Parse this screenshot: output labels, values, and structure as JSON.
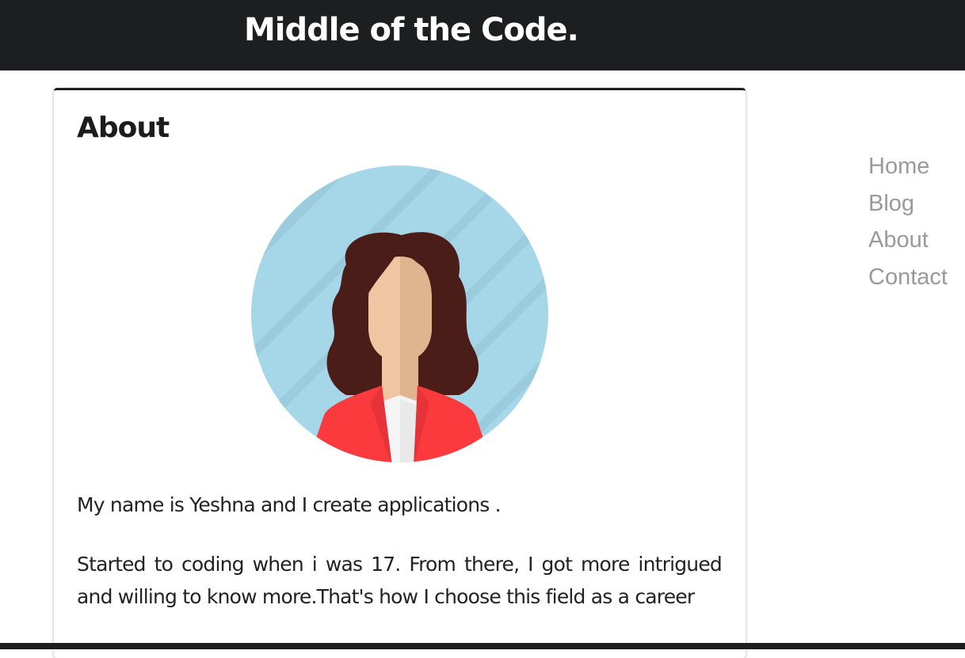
{
  "header": {
    "site_title": "Middle of the Code."
  },
  "about": {
    "heading": "About",
    "avatar_icon": "woman-avatar-icon",
    "paragraphs": [
      "My name is Yeshna and I create applications .",
      "Started to coding when i was 17. From there, I got more intrigued and willing to know more.That's how I choose this field as a career"
    ]
  },
  "nav": {
    "items": [
      {
        "label": "Home"
      },
      {
        "label": "Blog"
      },
      {
        "label": "About"
      },
      {
        "label": "Contact"
      }
    ]
  },
  "colors": {
    "header_bg": "#1d1e20",
    "nav_link": "#9a9a9a",
    "avatar_bg": "#a5d7e8",
    "hair": "#4a1d19",
    "skin": "#efc6a1",
    "jacket": "#fb3a3e"
  }
}
